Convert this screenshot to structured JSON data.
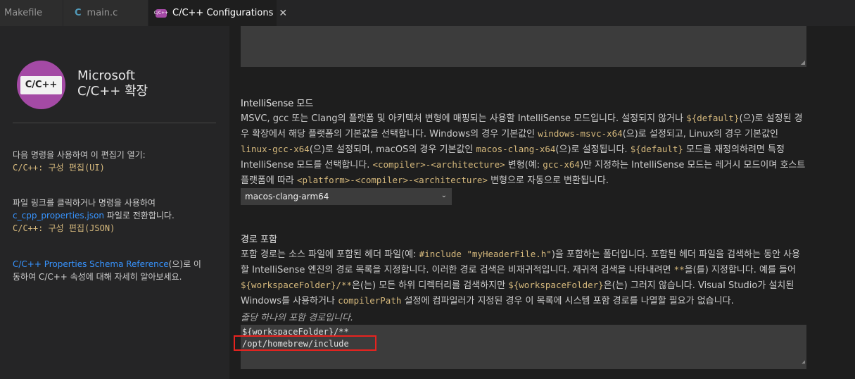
{
  "tabs": [
    {
      "label": "Makefile"
    },
    {
      "label": "main.c",
      "icon": "C"
    },
    {
      "label": "C/C++ Configurations",
      "icon_text": "C/C++"
    }
  ],
  "sidebar": {
    "logo_text": "C/C++",
    "brand_line1": "Microsoft",
    "brand_line2": "C/C++ 확장",
    "block1_text": "다음 명령을 사용하여 이 편집기 열기:",
    "block1_cmd": "C/C++: 구성 편집(UI)",
    "block2_line1": "파일 링크를 클릭하거나 명령을 사용하여",
    "block2_link": "c_cpp_properties.json",
    "block2_tail": " 파일로 전환합니다.",
    "block2_cmd": "C/C++: 구성 편집(JSON)",
    "block3_link": "C/C++ Properties Schema Reference",
    "block3_tail1": "(으)로 이",
    "block3_line2": "동하여 C/C++ 속성에 대해 자세히 알아보세요."
  },
  "intellisense": {
    "title": "IntelliSense 모드",
    "p1": "MSVC, gcc 또는 Clang의 플랫폼 및 아키텍처 변형에 매핑되는 사용할 IntelliSense 모드입니다. 설정되지 않거나 ",
    "c1": "${default}",
    "p2": "(으)로 설정된 경우 확장에서 해당 플랫폼의 기본값을 선택합니다. Windows의 경우 기본값인 ",
    "c2": "windows-msvc-x64",
    "p3": "(으)로 설정되고, Linux의 경우 기본값인 ",
    "c3": "linux-gcc-x64",
    "p4": "(으)로 설정되며, macOS의 경우 기본값인 ",
    "c4": "macos-clang-x64",
    "p5": "(으)로 설정됩니다. ",
    "c5": "${default}",
    "p6": " 모드를 재정의하려면 특정 IntelliSense 모드를 선택합니다. ",
    "c6": "<compiler>-<architecture>",
    "p7": " 변형(예: ",
    "c7": "gcc-x64",
    "p8": ")만 지정하는 IntelliSense 모드는 레거시 모드이며 호스트 플랫폼에 따라 ",
    "c8": "<platform>-<compiler>-<architecture>",
    "p9": " 변형으로 자동으로 변환됩니다.",
    "selected": "macos-clang-arm64"
  },
  "include": {
    "title": "경로 포함",
    "p1": "포함 경로는 소스 파일에 포함된 헤더 파일(예: ",
    "c1": "#include \"myHeaderFile.h\"",
    "p2": ")을 포함하는 폴더입니다. 포함된 헤더 파일을 검색하는 동안 사용할 IntelliSense 엔진의 경로 목록을 지정합니다. 이러한 경로 검색은 비재귀적입니다. 재귀적 검색을 나타내려면 ",
    "c2": "**",
    "p3": "을(를) 지정합니다. 예를 들어 ",
    "c3": "${workspaceFolder}/**",
    "p4": "은(는) 모든 하위 디렉터리를 검색하지만 ",
    "c4": "${workspaceFolder}",
    "p5": "은(는) 그러지 않습니다. Visual Studio가 설치된 Windows를 사용하거나 ",
    "c5": "compilerPath",
    "p6": " 설정에 컴파일러가 지정된 경우 이 목록에 시스템 포함 경로를 나열할 필요가 없습니다.",
    "hint": "줄당 하나의 포함 경로입니다.",
    "line1": "${workspaceFolder}/**",
    "line2": "/opt/homebrew/include"
  },
  "colors": {
    "accent_code": "#d7ba7d",
    "link": "#3794ff",
    "logo": "#a44aa5",
    "highlight": "#e8231f"
  }
}
